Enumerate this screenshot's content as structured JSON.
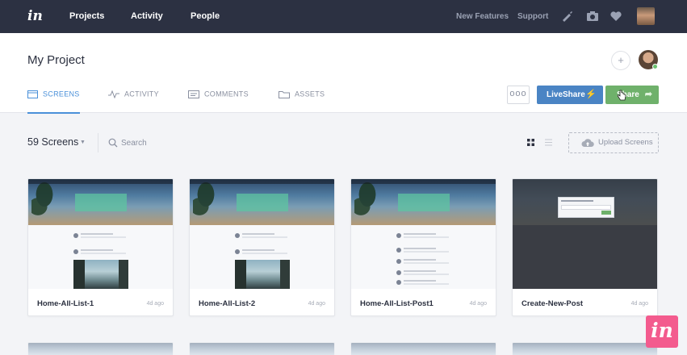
{
  "colors": {
    "nav_bg": "#2c3142",
    "accent_blue": "#4a90d9",
    "liveshare": "#4a84c4",
    "share_green": "#6fb16b",
    "brand_pink": "#f35b8e"
  },
  "topnav": {
    "logo_text": "in",
    "links": [
      "Projects",
      "Activity",
      "People"
    ],
    "right_links": [
      "New Features",
      "Support"
    ],
    "icons": [
      "pen-icon",
      "camera-icon",
      "heart-icon"
    ]
  },
  "project": {
    "title": "My Project",
    "add_label": "+"
  },
  "tabs": [
    {
      "label": "SCREENS",
      "icon": "screens-icon",
      "active": true
    },
    {
      "label": "ACTIVITY",
      "icon": "activity-icon",
      "active": false
    },
    {
      "label": "COMMENTS",
      "icon": "comments-icon",
      "active": false
    },
    {
      "label": "ASSETS",
      "icon": "folder-icon",
      "active": false
    }
  ],
  "actions": {
    "more_label": "ooo",
    "liveshare_label": "LiveShare",
    "share_label": "Share"
  },
  "toolbar": {
    "screen_count": "59 Screens",
    "search_placeholder": "Search",
    "upload_label": "Upload Screens"
  },
  "screens": [
    {
      "name": "Home-All-List-1",
      "time": "4d ago"
    },
    {
      "name": "Home-All-List-2",
      "time": "4d ago"
    },
    {
      "name": "Home-All-List-Post1",
      "time": "4d ago"
    },
    {
      "name": "Create-New-Post",
      "time": "4d ago"
    }
  ],
  "badge": {
    "text": "in"
  }
}
